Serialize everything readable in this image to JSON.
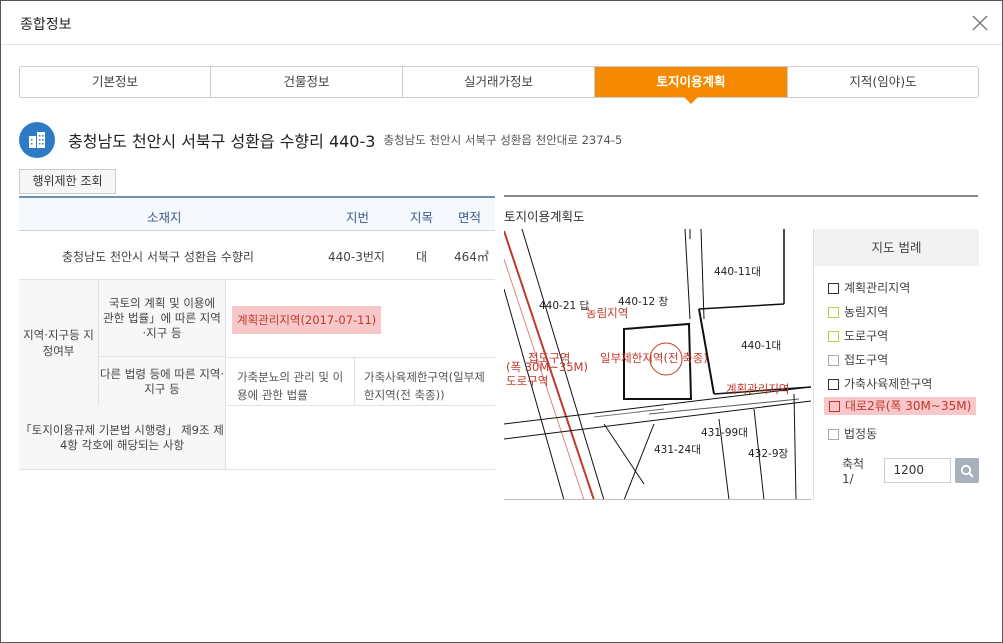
{
  "dialog": {
    "title": "종합정보"
  },
  "tabs": [
    {
      "label": "기본정보",
      "active": false
    },
    {
      "label": "건물정보",
      "active": false
    },
    {
      "label": "실거래가정보",
      "active": false
    },
    {
      "label": "토지이용계획",
      "active": true
    },
    {
      "label": "지적(임야)도",
      "active": false
    }
  ],
  "address": {
    "main": "충청남도 천안시 서북구 성환읍 수향리 440-3",
    "road": "충청남도 천안시 서북구 성환읍 천안대로 2374-5"
  },
  "restrict_button": "행위제한 조회",
  "table": {
    "headers": {
      "location": "소재지",
      "lot": "지번",
      "category": "지목",
      "area": "면적"
    },
    "row": {
      "location": "충청남도 천안시 서북구 성환읍 수향리",
      "lot": "440-3번지",
      "category": "대",
      "area": "464㎡"
    },
    "zone_head": "지역·지구등 지정여부",
    "zone_sub1": "국토의 계획 및 이용에 관한 법률」에 따른 지역·지구 등",
    "zone_val1": "계획관리지역(2017-07-11)",
    "zone_sub2": "다른 법령 등에 따른 지역·지구 등",
    "zone_val2a": "가축분뇨의 관리 및 이용에 관한 법률",
    "zone_val2b": "가축사육제한구역(일부제한지역(전 축종))",
    "row3_head": "「토지이용규제 기본법 시행령」 제9조 제4항 각호에 해당되는 사항"
  },
  "map": {
    "title": "토지이용계획도",
    "labels": {
      "lot_440_11": "440-11대",
      "lot_440_21": "440-21 답",
      "lot_440_12": "440-12 창",
      "lot_440_1": "440-1대",
      "lot_431_24": "431-24대",
      "lot_431_99": "431-99대",
      "lot_432_9": "432-9장",
      "farm_zone": "농림지역",
      "road_contact": "접도구역",
      "small_road": "도로구역",
      "width_label": "(폭 30M~35M)",
      "partial_limit": "일부제한지역(전 축종)",
      "plan_zone": "계획관리지역"
    }
  },
  "legend": {
    "title": "지도 범례",
    "items": [
      {
        "label": "계획관리지역",
        "color": "#333333",
        "highlight": false
      },
      {
        "label": "농림지역",
        "color": "#c8c84a",
        "highlight": false
      },
      {
        "label": "도로구역",
        "color": "#c8c84a",
        "highlight": false
      },
      {
        "label": "접도구역",
        "color": "#aaaaaa",
        "highlight": false
      },
      {
        "label": "가축사육제한구역",
        "color": "#333333",
        "highlight": false
      },
      {
        "label": "대로2류(폭 30M~35M)",
        "color": "#c0392b",
        "highlight": true
      },
      {
        "label": "법정동",
        "color": "#aaaaaa",
        "highlight": false
      }
    ],
    "scale_label": "축척 1/",
    "scale_value": "1200"
  }
}
